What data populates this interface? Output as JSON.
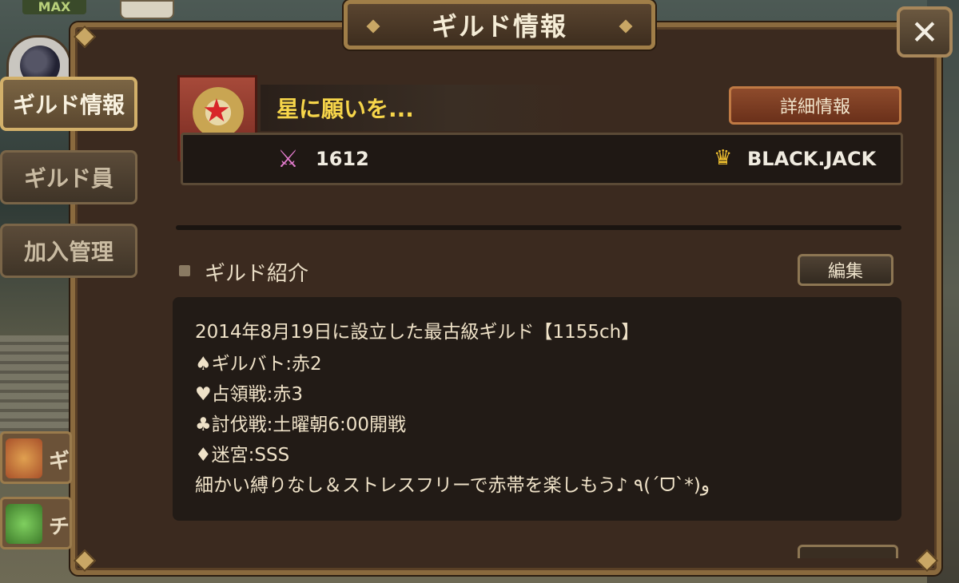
{
  "top_left": {
    "max_label": "MAX"
  },
  "window": {
    "title": "ギルド情報",
    "close_label": "✕"
  },
  "tabs": [
    {
      "label": "ギルド情報",
      "active": true
    },
    {
      "label": "ギルド員",
      "active": false
    },
    {
      "label": "加入管理",
      "active": false
    }
  ],
  "side_items": [
    {
      "label": "ギ",
      "icon": "scroll-icon"
    },
    {
      "label": "チ",
      "icon": "check-icon"
    }
  ],
  "guild": {
    "name": "星に願いを...",
    "detail_button": "詳細情報",
    "points": "1612",
    "leader": "BLACK.JACK",
    "emblem_stars": "★★★"
  },
  "intro": {
    "label": "ギルド紹介",
    "edit_button": "編集",
    "lines": [
      "2014年8月19日に設立した最古級ギルド【1155ch】",
      "♠ギルバト:赤2",
      "♥占領戦:赤3",
      "♣討伐戦:土曜朝6:00開戦",
      "♦迷宮:SSS",
      "細かい縛りなし＆ストレスフリーで赤帯を楽しもう♪ ٩(ˊᗜˋ*)و"
    ]
  },
  "colors": {
    "guild_name": "#f7d64a",
    "panel_bg": "#3b2a1f",
    "frame": "#8a6a3e",
    "detail_button": "#8e4b2c"
  }
}
